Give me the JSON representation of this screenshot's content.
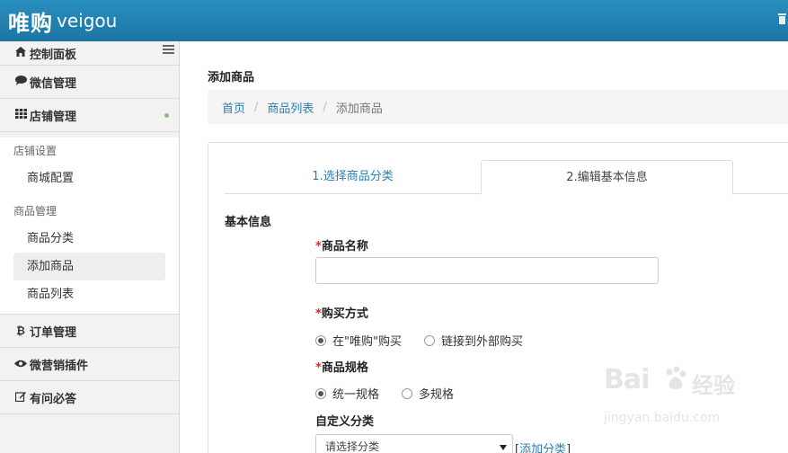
{
  "header": {
    "logo_cn": "唯购",
    "logo_en": "veigou"
  },
  "sidebar": {
    "items": [
      {
        "label": "控制面板",
        "icon": "home-icon"
      },
      {
        "label": "微信管理",
        "icon": "comment-icon"
      },
      {
        "label": "店铺管理",
        "icon": "grid-icon"
      },
      {
        "label": "订单管理",
        "icon": "bitcoin-icon"
      },
      {
        "label": "微营销插件",
        "icon": "eye-icon"
      },
      {
        "label": "有问必答",
        "icon": "edit-icon"
      }
    ],
    "groups": [
      {
        "title": "店铺设置",
        "items": [
          "商城配置"
        ]
      },
      {
        "title": "商品管理",
        "items": [
          "商品分类",
          "添加商品",
          "商品列表"
        ]
      }
    ],
    "active_item": "添加商品"
  },
  "main": {
    "title": "添加商品",
    "breadcrumb": [
      "首页",
      "商品列表",
      "添加商品"
    ],
    "tabs": [
      "1.选择商品分类",
      "2.编辑基本信息"
    ],
    "active_tab": "2.编辑基本信息",
    "section_title": "基本信息",
    "fields": {
      "name_label": "商品名称",
      "purchase_label": "购买方式",
      "purchase_options": [
        "在\"唯购\"购买",
        "链接到外部购买"
      ],
      "spec_label": "商品规格",
      "spec_options": [
        "统一规格",
        "多规格"
      ],
      "custom_label": "自定义分类",
      "custom_select": "请选择分类",
      "add_category_link": "添加分类",
      "required_mark": "*"
    }
  },
  "watermark": {
    "logo": "Bai",
    "cn": "经验",
    "url": "jingyan.baidu.com"
  }
}
